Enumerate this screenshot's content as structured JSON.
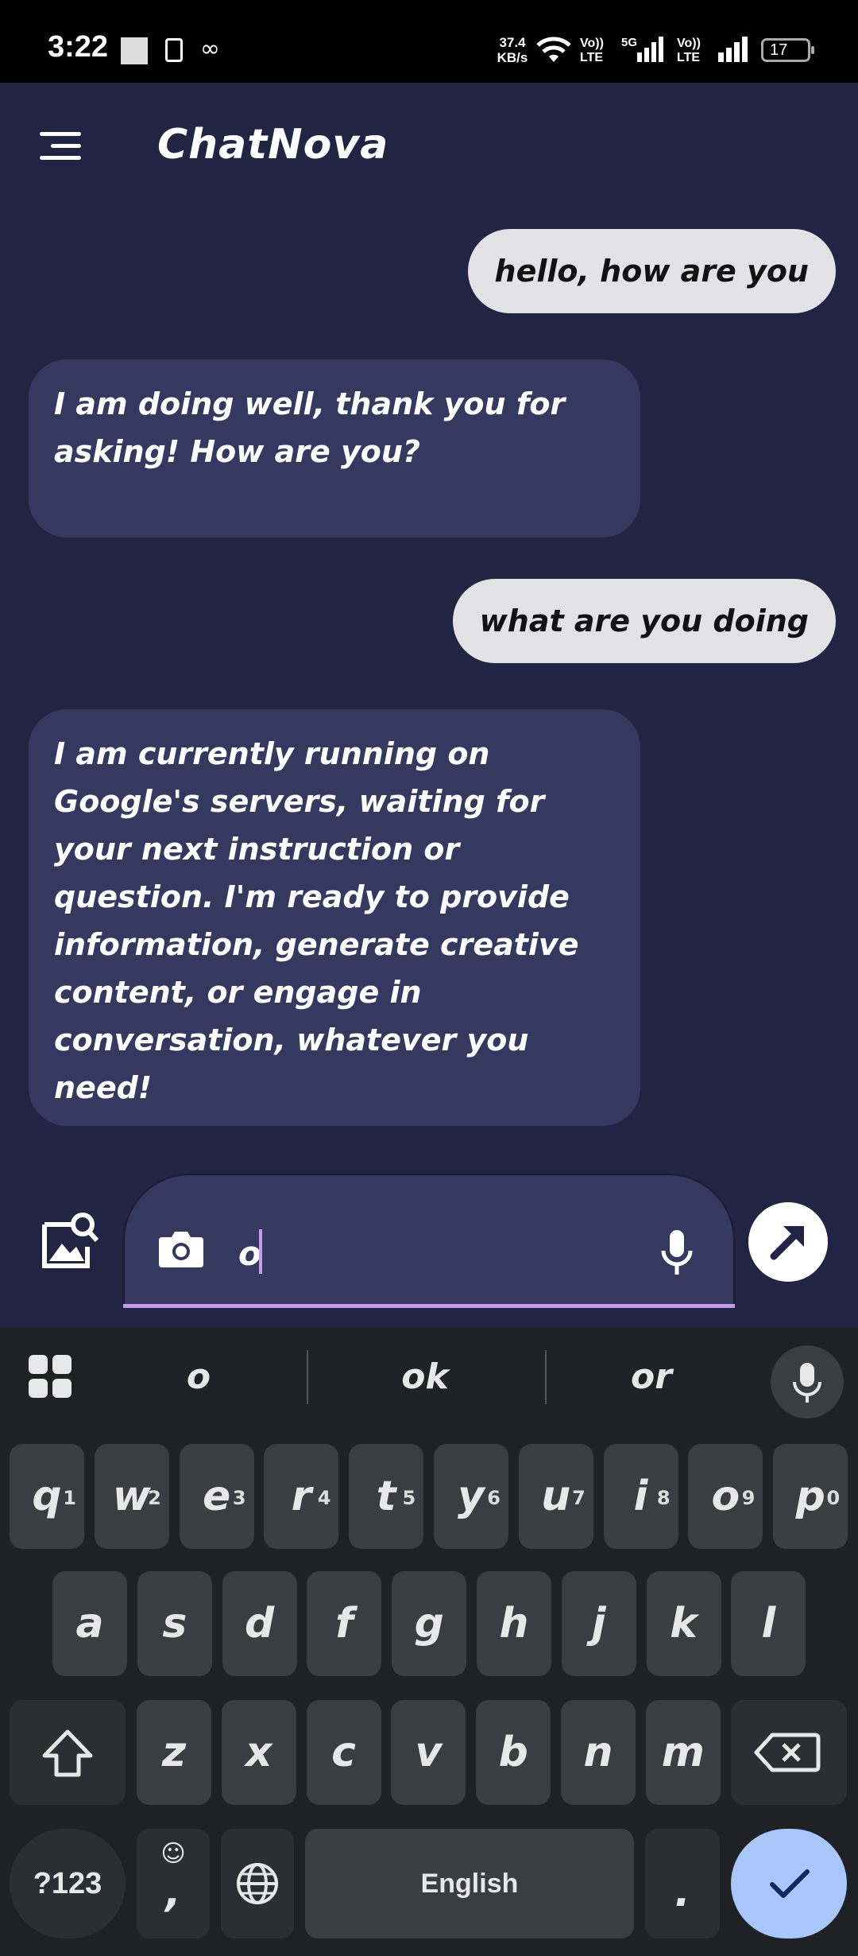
{
  "status_bar": {
    "time": "3:22",
    "net_speed_value": "37.4",
    "net_speed_unit": "KB/s",
    "sim1_label_top": "Vo))",
    "sim1_label_bottom": "LTE",
    "sim1_network": "5G",
    "sim2_label_top": "Vo))",
    "sim2_label_bottom": "LTE",
    "battery_level": "17"
  },
  "header": {
    "title": "ChatNova"
  },
  "messages": [
    {
      "role": "user",
      "text": "hello, how are you"
    },
    {
      "role": "bot",
      "text": "I am doing well, thank you for asking! How are you?"
    },
    {
      "role": "user",
      "text": "what are you doing"
    },
    {
      "role": "bot",
      "text": "I am currently running on Google's servers, waiting for your next instruction or question. I'm ready to provide information, generate creative content, or engage in conversation, whatever you need!"
    }
  ],
  "input": {
    "value": "o"
  },
  "keyboard": {
    "suggestions": [
      "o",
      "ok",
      "or"
    ],
    "row1": [
      {
        "key": "q",
        "hint": "1"
      },
      {
        "key": "w",
        "hint": "2"
      },
      {
        "key": "e",
        "hint": "3"
      },
      {
        "key": "r",
        "hint": "4"
      },
      {
        "key": "t",
        "hint": "5"
      },
      {
        "key": "y",
        "hint": "6"
      },
      {
        "key": "u",
        "hint": "7"
      },
      {
        "key": "i",
        "hint": "8"
      },
      {
        "key": "o",
        "hint": "9"
      },
      {
        "key": "p",
        "hint": "0"
      }
    ],
    "row2": [
      "a",
      "s",
      "d",
      "f",
      "g",
      "h",
      "j",
      "k",
      "l"
    ],
    "row3": [
      "z",
      "x",
      "c",
      "v",
      "b",
      "n",
      "m"
    ],
    "symbols_label": "?123",
    "comma_label": ",",
    "space_label": "English",
    "period_label": "."
  },
  "colors": {
    "background": "#222443",
    "bot_bubble": "#353960",
    "user_bubble": "#e3e3e6",
    "accent_underline": "#c79cf0",
    "enter_key": "#a8c7fa"
  }
}
